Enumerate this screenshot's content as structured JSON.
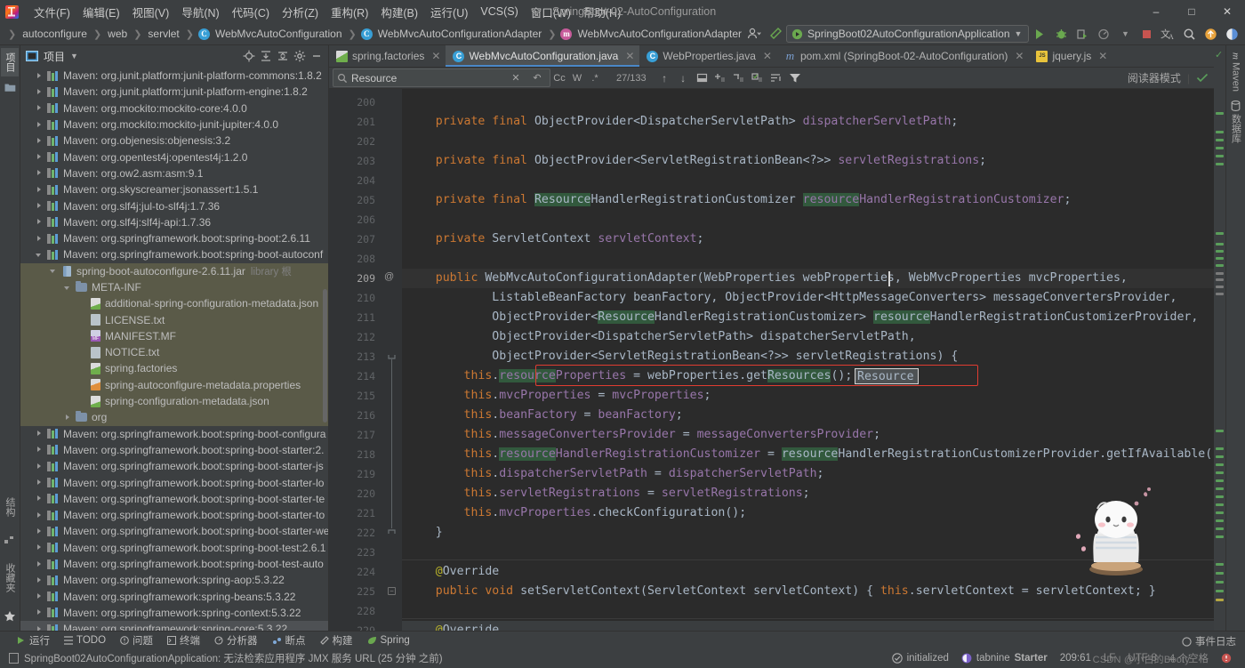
{
  "window": {
    "title": "SpringBoot-02-AutoConfiguration",
    "minimize": "—",
    "maximize": "☐",
    "close": "✕"
  },
  "menubar": {
    "items": [
      {
        "label": "文件(F)"
      },
      {
        "label": "编辑(E)"
      },
      {
        "label": "视图(V)"
      },
      {
        "label": "导航(N)"
      },
      {
        "label": "代码(C)"
      },
      {
        "label": "分析(Z)"
      },
      {
        "label": "重构(R)"
      },
      {
        "label": "构建(B)"
      },
      {
        "label": "运行(U)"
      },
      {
        "label": "VCS(S)"
      },
      {
        "label": "窗口(W)"
      },
      {
        "label": "帮助(H)"
      }
    ]
  },
  "breadcrumb": {
    "items": [
      {
        "label": "autoconfigure",
        "icon": ""
      },
      {
        "label": "web",
        "icon": ""
      },
      {
        "label": "servlet",
        "icon": ""
      },
      {
        "label": "WebMvcAutoConfiguration",
        "icon": "class-icon"
      },
      {
        "label": "WebMvcAutoConfigurationAdapter",
        "icon": "class-icon"
      },
      {
        "label": "WebMvcAutoConfigurationAdapter",
        "icon": "method-icon"
      }
    ]
  },
  "toolbar": {
    "run_configuration": "SpringBoot02AutoConfigurationApplication",
    "icons": [
      "user-avatar-icon",
      "build-hammer-icon",
      "run-icon",
      "debug-icon",
      "run-with-coverage-icon",
      "profile-icon",
      "stop-icon",
      "translate-icon",
      "search-everywhere-icon",
      "update-icon",
      "ide-icon"
    ]
  },
  "left_rail": {
    "top": [
      {
        "label": "项目",
        "selected": true
      },
      {
        "label": "folder-icon",
        "selected": false
      }
    ],
    "bottom": [
      {
        "label": "结构"
      },
      {
        "label": "收藏夹"
      }
    ]
  },
  "right_rail": {
    "items": [
      {
        "label": "Maven"
      },
      {
        "label": "数据库"
      }
    ]
  },
  "project_panel": {
    "title": "项目",
    "header_icons": [
      "locate-icon",
      "expand-all-icon",
      "collapse-all-icon",
      "settings-gear-icon",
      "hide-icon"
    ],
    "tree": [
      {
        "indent": 1,
        "arrow": "right",
        "icon": "maven-lib-icon",
        "label": "Maven: org.junit.platform:junit-platform-commons:1.8.2"
      },
      {
        "indent": 1,
        "arrow": "right",
        "icon": "maven-lib-icon",
        "label": "Maven: org.junit.platform:junit-platform-engine:1.8.2"
      },
      {
        "indent": 1,
        "arrow": "right",
        "icon": "maven-lib-icon",
        "label": "Maven: org.mockito:mockito-core:4.0.0"
      },
      {
        "indent": 1,
        "arrow": "right",
        "icon": "maven-lib-icon",
        "label": "Maven: org.mockito:mockito-junit-jupiter:4.0.0"
      },
      {
        "indent": 1,
        "arrow": "right",
        "icon": "maven-lib-icon",
        "label": "Maven: org.objenesis:objenesis:3.2"
      },
      {
        "indent": 1,
        "arrow": "right",
        "icon": "maven-lib-icon",
        "label": "Maven: org.opentest4j:opentest4j:1.2.0"
      },
      {
        "indent": 1,
        "arrow": "right",
        "icon": "maven-lib-icon",
        "label": "Maven: org.ow2.asm:asm:9.1"
      },
      {
        "indent": 1,
        "arrow": "right",
        "icon": "maven-lib-icon",
        "label": "Maven: org.skyscreamer:jsonassert:1.5.1"
      },
      {
        "indent": 1,
        "arrow": "right",
        "icon": "maven-lib-icon",
        "label": "Maven: org.slf4j:jul-to-slf4j:1.7.36"
      },
      {
        "indent": 1,
        "arrow": "right",
        "icon": "maven-lib-icon",
        "label": "Maven: org.slf4j:slf4j-api:1.7.36"
      },
      {
        "indent": 1,
        "arrow": "right",
        "icon": "maven-lib-icon",
        "label": "Maven: org.springframework.boot:spring-boot:2.6.11"
      },
      {
        "indent": 1,
        "arrow": "down",
        "icon": "maven-lib-icon",
        "label": "Maven: org.springframework.boot:spring-boot-autoconf"
      },
      {
        "indent": 2,
        "arrow": "down",
        "icon": "jar-icon",
        "label": "spring-boot-autoconfigure-2.6.11.jar",
        "suffix": "library 根",
        "highlight": true
      },
      {
        "indent": 3,
        "arrow": "down",
        "icon": "folder-icon",
        "label": "META-INF",
        "highlight": true
      },
      {
        "indent": 4,
        "arrow": "none",
        "icon": "json-file-icon",
        "label": "additional-spring-configuration-metadata.json",
        "highlight": true
      },
      {
        "indent": 4,
        "arrow": "none",
        "icon": "txt-file-icon",
        "label": "LICENSE.txt",
        "highlight": true
      },
      {
        "indent": 4,
        "arrow": "none",
        "icon": "manifest-file-icon",
        "label": "MANIFEST.MF",
        "highlight": true
      },
      {
        "indent": 4,
        "arrow": "none",
        "icon": "txt-file-icon",
        "label": "NOTICE.txt",
        "highlight": true
      },
      {
        "indent": 4,
        "arrow": "none",
        "icon": "factories-file-icon",
        "label": "spring.factories",
        "highlight": true
      },
      {
        "indent": 4,
        "arrow": "none",
        "icon": "properties-file-icon",
        "label": "spring-autoconfigure-metadata.properties",
        "highlight": true
      },
      {
        "indent": 4,
        "arrow": "none",
        "icon": "json-file-icon",
        "label": "spring-configuration-metadata.json",
        "highlight": true
      },
      {
        "indent": 3,
        "arrow": "right",
        "icon": "folder-icon",
        "label": "org",
        "highlight": true
      },
      {
        "indent": 1,
        "arrow": "right",
        "icon": "maven-lib-icon",
        "label": "Maven: org.springframework.boot:spring-boot-configura"
      },
      {
        "indent": 1,
        "arrow": "right",
        "icon": "maven-lib-icon",
        "label": "Maven: org.springframework.boot:spring-boot-starter:2."
      },
      {
        "indent": 1,
        "arrow": "right",
        "icon": "maven-lib-icon",
        "label": "Maven: org.springframework.boot:spring-boot-starter-js"
      },
      {
        "indent": 1,
        "arrow": "right",
        "icon": "maven-lib-icon",
        "label": "Maven: org.springframework.boot:spring-boot-starter-lo"
      },
      {
        "indent": 1,
        "arrow": "right",
        "icon": "maven-lib-icon",
        "label": "Maven: org.springframework.boot:spring-boot-starter-te"
      },
      {
        "indent": 1,
        "arrow": "right",
        "icon": "maven-lib-icon",
        "label": "Maven: org.springframework.boot:spring-boot-starter-to"
      },
      {
        "indent": 1,
        "arrow": "right",
        "icon": "maven-lib-icon",
        "label": "Maven: org.springframework.boot:spring-boot-starter-we"
      },
      {
        "indent": 1,
        "arrow": "right",
        "icon": "maven-lib-icon",
        "label": "Maven: org.springframework.boot:spring-boot-test:2.6.1"
      },
      {
        "indent": 1,
        "arrow": "right",
        "icon": "maven-lib-icon",
        "label": "Maven: org.springframework.boot:spring-boot-test-auto"
      },
      {
        "indent": 1,
        "arrow": "right",
        "icon": "maven-lib-icon",
        "label": "Maven: org.springframework:spring-aop:5.3.22"
      },
      {
        "indent": 1,
        "arrow": "right",
        "icon": "maven-lib-icon",
        "label": "Maven: org.springframework:spring-beans:5.3.22"
      },
      {
        "indent": 1,
        "arrow": "right",
        "icon": "maven-lib-icon",
        "label": "Maven: org.springframework:spring-context:5.3.22"
      },
      {
        "indent": 1,
        "arrow": "right",
        "icon": "maven-lib-icon",
        "label": "Maven: org.springframework:spring-core:5.3.22",
        "selected": true
      }
    ]
  },
  "editor_tabs": [
    {
      "label": "spring.factories",
      "icon": "factories-file-icon",
      "active": false
    },
    {
      "label": "WebMvcAutoConfiguration.java",
      "icon": "java-class-icon",
      "active": true
    },
    {
      "label": "WebProperties.java",
      "icon": "java-class-icon",
      "active": false
    },
    {
      "label": "pom.xml (SpringBoot-02-AutoConfiguration)",
      "icon": "maven-xml-icon",
      "active": false
    },
    {
      "label": "jquery.js",
      "icon": "js-file-icon",
      "active": false
    }
  ],
  "findbar": {
    "query": "Resource",
    "match_count": "27/133",
    "options": [
      "Cc",
      "W",
      ".*"
    ],
    "icons": [
      "search-icon",
      "clear-icon",
      "history-icon",
      "prev-match-icon",
      "next-match-icon",
      "select-all-icon",
      "add-line-icon",
      "remove-line-icon",
      "edit-lines-icon",
      "filter-lines-icon",
      "filter-icon"
    ],
    "reader_mode": "阅读器模式"
  },
  "code": {
    "lines": [
      {
        "n": "200",
        "text": ""
      },
      {
        "n": "201",
        "text": "    private final ObjectProvider<DispatcherServletPath> dispatcherServletPath;"
      },
      {
        "n": "202",
        "text": ""
      },
      {
        "n": "203",
        "text": "    private final ObjectProvider<ServletRegistrationBean<?>> servletRegistrations;"
      },
      {
        "n": "204",
        "text": ""
      },
      {
        "n": "205",
        "text": "    private final ResourceHandlerRegistrationCustomizer resourceHandlerRegistrationCustomizer;"
      },
      {
        "n": "206",
        "text": ""
      },
      {
        "n": "207",
        "text": "    private ServletContext servletContext;"
      },
      {
        "n": "208",
        "text": ""
      },
      {
        "n": "209",
        "text": "    public WebMvcAutoConfigurationAdapter(WebProperties webProperties, WebMvcProperties mvcProperties,"
      },
      {
        "n": "210",
        "text": "            ListableBeanFactory beanFactory, ObjectProvider<HttpMessageConverters> messageConvertersProvider,"
      },
      {
        "n": "211",
        "text": "            ObjectProvider<ResourceHandlerRegistrationCustomizer> resourceHandlerRegistrationCustomizerProvider,"
      },
      {
        "n": "212",
        "text": "            ObjectProvider<DispatcherServletPath> dispatcherServletPath,"
      },
      {
        "n": "213",
        "text": "            ObjectProvider<ServletRegistrationBean<?>> servletRegistrations) {"
      },
      {
        "n": "214",
        "text": "        this.resourceProperties = webProperties.getResources();"
      },
      {
        "n": "215",
        "text": "        this.mvcProperties = mvcProperties;"
      },
      {
        "n": "216",
        "text": "        this.beanFactory = beanFactory;"
      },
      {
        "n": "217",
        "text": "        this.messageConvertersProvider = messageConvertersProvider;"
      },
      {
        "n": "218",
        "text": "        this.resourceHandlerRegistrationCustomizer = resourceHandlerRegistrationCustomizerProvider.getIfAvailable();"
      },
      {
        "n": "219",
        "text": "        this.dispatcherServletPath = dispatcherServletPath;"
      },
      {
        "n": "220",
        "text": "        this.servletRegistrations = servletRegistrations;"
      },
      {
        "n": "221",
        "text": "        this.mvcProperties.checkConfiguration();"
      },
      {
        "n": "222",
        "text": "    }"
      },
      {
        "n": "223",
        "text": ""
      },
      {
        "n": "224",
        "text": "    @Override"
      },
      {
        "n": "225",
        "text": "    public void setServletContext(ServletContext servletContext) { this.servletContext = servletContext; }"
      },
      {
        "n": "228",
        "text": ""
      },
      {
        "n": "229",
        "text": "    @Override"
      }
    ],
    "gutter_annotation_209": "@",
    "gutter_annotation_225": "override-marker"
  },
  "bottom_toolwindows": [
    {
      "label": "运行",
      "icon": "run-icon"
    },
    {
      "label": "TODO",
      "icon": "todo-icon"
    },
    {
      "label": "问题",
      "icon": "problems-icon"
    },
    {
      "label": "终端",
      "icon": "terminal-icon"
    },
    {
      "label": "分析器",
      "icon": "profiler-icon"
    },
    {
      "label": "断点",
      "icon": "breakpoints-icon"
    },
    {
      "label": "构建",
      "icon": "build-icon"
    },
    {
      "label": "Spring",
      "icon": "spring-leaf-icon"
    }
  ],
  "statusbar": {
    "message": "SpringBoot02AutoConfigurationApplication: 无法检索应用程序 JMX 服务 URL (25 分钟 之前)",
    "event_log": "事件日志",
    "initialized": "initialized",
    "tabnine": "tabnine",
    "tabnine_plan": "Starter",
    "caret_position": "209:61",
    "line_separator": "LF",
    "encoding": "UTF-8",
    "indent": "4 个空格",
    "watermark": "CSDN @小白的Booty"
  },
  "colors": {
    "accent_blue": "#4a88c7",
    "search_highlight": "#32593d",
    "annotation_red": "#e03c31",
    "keyword_orange": "#cc7832",
    "field_purple": "#9876aa",
    "annotation_yellow": "#bbb529",
    "number_blue": "#6897bb",
    "bg_editor": "#2b2b2b",
    "bg_panel": "#3c3f41"
  }
}
